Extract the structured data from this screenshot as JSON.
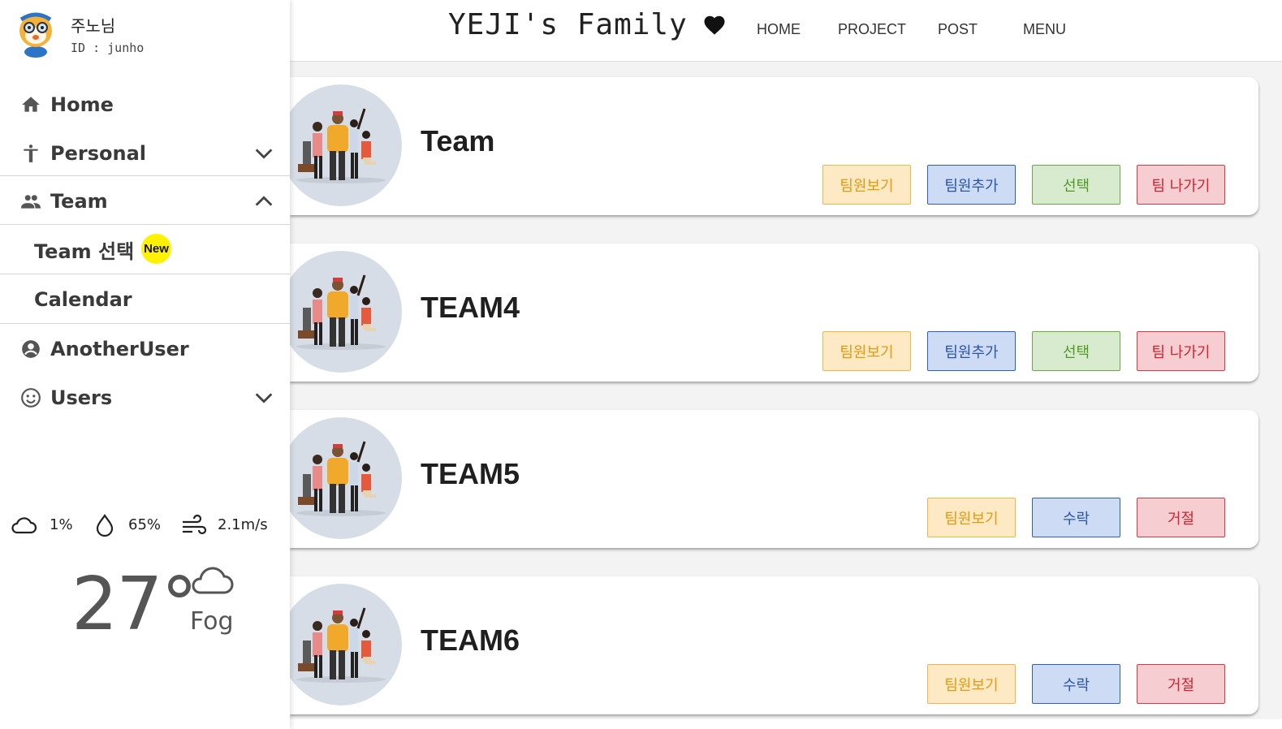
{
  "header": {
    "brand": "YEJI's Family",
    "nav": [
      "HOME",
      "PROJECT",
      "POST",
      "MENU"
    ]
  },
  "profile": {
    "name": "주노님",
    "id": "ID : junho"
  },
  "sidebar": {
    "items": [
      {
        "label": "Home",
        "icon": "home-icon"
      },
      {
        "label": "Personal",
        "icon": "person-icon",
        "chevron": "down"
      },
      {
        "label": "Team",
        "icon": "people-icon",
        "chevron": "up"
      },
      {
        "label": "Team 선택",
        "badge": "New"
      },
      {
        "label": "Calendar"
      },
      {
        "label": "AnotherUser",
        "icon": "account-icon"
      },
      {
        "label": "Users",
        "icon": "smile-icon",
        "chevron": "down"
      }
    ]
  },
  "weather": {
    "cloud": "1%",
    "humidity": "65%",
    "wind": "2.1m/s",
    "temperature": "27°",
    "condition": "Fog"
  },
  "teams": [
    {
      "name": "Team",
      "buttons": [
        "팀원보기",
        "팀원추가",
        "선택",
        "팀 나가기"
      ]
    },
    {
      "name": "TEAM4",
      "buttons": [
        "팀원보기",
        "팀원추가",
        "선택",
        "팀 나가기"
      ]
    },
    {
      "name": "TEAM5",
      "buttons": [
        "팀원보기",
        "수락",
        "거절"
      ]
    },
    {
      "name": "TEAM6",
      "buttons": [
        "팀원보기",
        "수락",
        "거절"
      ]
    }
  ],
  "colors": {
    "view": "#e39a0f",
    "add": "#2b55a8",
    "select": "#4f9a26",
    "leave": "#cf2330",
    "badge": "#fff200"
  }
}
